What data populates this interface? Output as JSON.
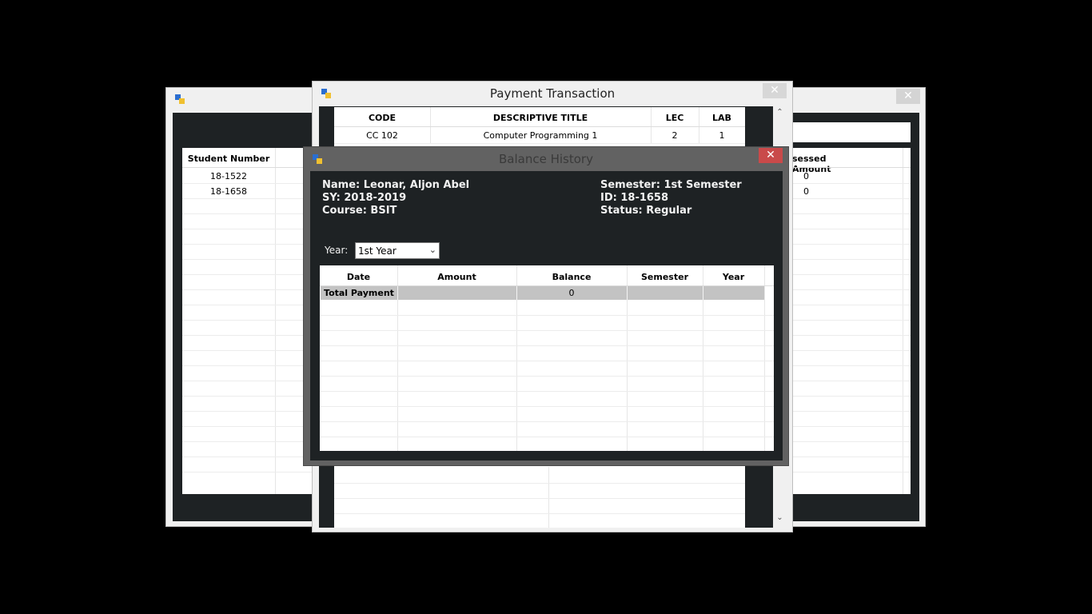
{
  "left_window": {
    "grid": {
      "header": "Student Number",
      "rows": [
        "18-1522",
        "18-1658"
      ]
    }
  },
  "right_window": {
    "close_label": "✕",
    "grid": {
      "header": "sessed Amount",
      "rows": [
        "0",
        "0"
      ]
    }
  },
  "payment_window": {
    "title": "Payment Transaction",
    "close_label": "✕",
    "columns": [
      "CODE",
      "DESCRIPTIVE TITLE",
      "LEC",
      "LAB"
    ],
    "rows": [
      {
        "code": "CC 102",
        "title": "Computer Programming 1",
        "lec": "2",
        "lab": "1"
      }
    ]
  },
  "balance_window": {
    "title": "Balance History",
    "close_label": "✕",
    "student": {
      "name": "Name: Leonar, Aljon Abel",
      "sy": "SY: 2018-2019",
      "course": "Course: BSIT",
      "semester": "Semester: 1st Semester",
      "id": "ID: 18-1658",
      "status": "Status: Regular"
    },
    "year_label": "Year:",
    "year_selected": "1st Year",
    "columns": [
      "Date",
      "Amount",
      "Balance",
      "Semester",
      "Year"
    ],
    "total_row": {
      "label": "Total Payment",
      "amount": "",
      "balance": "0",
      "semester": "",
      "year": ""
    }
  },
  "colors": {
    "dark_panel": "#1e2224",
    "close_active": "#c94a4a",
    "total_row": "#c3c3c3"
  }
}
